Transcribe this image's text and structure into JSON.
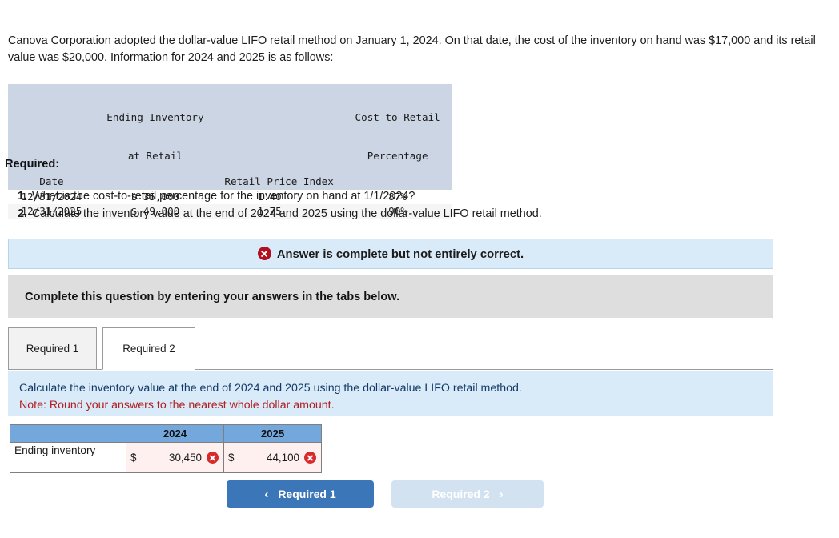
{
  "problem": {
    "text": "Canova Corporation adopted the dollar-value LIFO retail method on January 1, 2024. On that date, the cost of the inventory on hand was $17,000 and its retail value was $20,000. Information for 2024 and 2025 is as follows:"
  },
  "given_table": {
    "headers": {
      "date": "Date",
      "ending_inventory_line1": "Ending Inventory",
      "ending_inventory_line2": "at Retail",
      "retail_price_index": "Retail Price Index",
      "cost_to_retail_line1": "Cost-to-Retail",
      "cost_to_retail_line2": "Percentage"
    },
    "rows": [
      {
        "date": "12/31/2024",
        "ending_inventory_at_retail": "$ 35,000",
        "retail_price_index": "1.40",
        "cost_to_retail_percentage": "87%"
      },
      {
        "date": "12/31/2025",
        "ending_inventory_at_retail": "$ 49,000",
        "retail_price_index": "1.75",
        "cost_to_retail_percentage": "90%"
      }
    ]
  },
  "required": {
    "heading": "Required:",
    "items": [
      {
        "num": "1.",
        "text": "What is the cost-to-retail percentage for the inventory on hand at 1/1/2024?"
      },
      {
        "num": "2.",
        "text": "Calculate the inventory value at the end of 2024 and 2025 using the dollar-value LIFO retail method."
      }
    ]
  },
  "alert": {
    "icon": "error-x-icon",
    "message": "Answer is complete but not entirely correct."
  },
  "instruction_strip": {
    "text": "Complete this question by entering your answers in the tabs below."
  },
  "tabs": [
    {
      "label": "Required 1",
      "active": false
    },
    {
      "label": "Required 2",
      "active": true
    }
  ],
  "question_panel": {
    "line1": "Calculate the inventory value at the end of 2024 and 2025 using the dollar-value LIFO retail method.",
    "line2": "Note: Round your answers to the nearest whole dollar amount."
  },
  "answer_table": {
    "columns": [
      "",
      "2024",
      "2025"
    ],
    "rows": [
      {
        "label": "Ending inventory",
        "cells": [
          {
            "currency": "$",
            "value": "30,450",
            "status": "incorrect"
          },
          {
            "currency": "$",
            "value": "44,100",
            "status": "incorrect"
          }
        ]
      }
    ]
  },
  "navigation": {
    "prev": {
      "label": "Required 1",
      "chevron": "chevron-left-icon",
      "enabled": true
    },
    "next": {
      "label": "Required 2",
      "chevron": "chevron-right-icon",
      "enabled": false
    }
  },
  "colors": {
    "accent_blue": "#3a76b8",
    "table_header_blue": "#74a8dc",
    "panel_blue": "#d9eaf8",
    "gray_strip": "#dedede",
    "error_red": "#d62b2b",
    "alert_red": "#b01020",
    "note_red": "#b02020",
    "given_header": "#ccd5e4"
  }
}
